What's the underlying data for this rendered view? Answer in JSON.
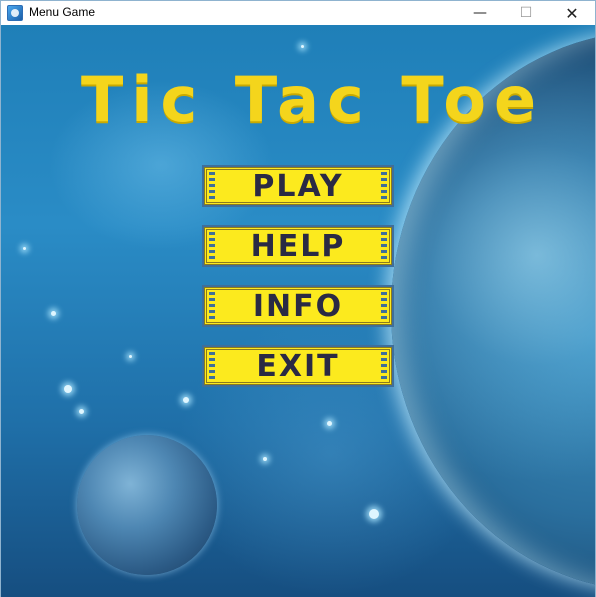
{
  "window": {
    "title": "Menu Game",
    "controls": {
      "minimize": "—",
      "maximize": "☐",
      "close": "✕"
    }
  },
  "game": {
    "title": "Tic Tac Toe"
  },
  "menu": {
    "play": "PLAY",
    "help": "HELP",
    "info": "INFO",
    "exit": "EXIT"
  },
  "colors": {
    "button_fill": "#fcea1e",
    "title_yellow": "#f4d51c",
    "button_text": "#2a2a44",
    "space_blue": "#1f7fb8"
  },
  "icons": {
    "app": "game-app-icon"
  }
}
